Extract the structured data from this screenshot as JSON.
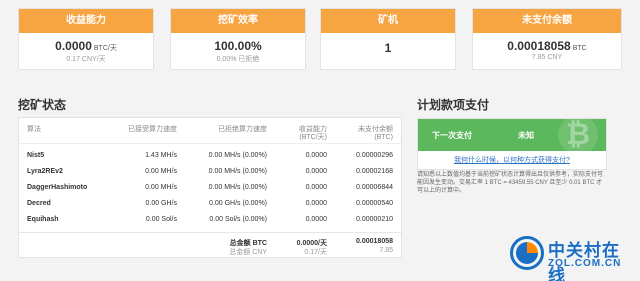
{
  "cards": [
    {
      "title": "收益能力",
      "value": "0.0000",
      "unit": "BTC/天",
      "sub": "0.17 CNY/天"
    },
    {
      "title": "挖矿效率",
      "value": "100.00%",
      "unit": "",
      "sub": "0.00% 已拒绝"
    },
    {
      "title": "矿机",
      "value": "1",
      "unit": "",
      "sub": ""
    },
    {
      "title": "未支付余额",
      "value": "0.00018058",
      "unit": "BTC",
      "sub": "7.85 CNY"
    }
  ],
  "mining_status": {
    "title": "挖矿状态",
    "columns": [
      "算法",
      "已接受算力速度",
      "已拒绝算力速度",
      "收益能力\n(BTC/天)",
      "未支付余额\n(BTC)"
    ],
    "rows": [
      {
        "algo": "Nist5",
        "accepted": "1.43 MH/s",
        "rejected": "0.00 MH/s (0.00%)",
        "profit": "0.0000",
        "unpaid": "0.00000296"
      },
      {
        "algo": "Lyra2REv2",
        "accepted": "0.00 MH/s",
        "rejected": "0.00 MH/s (0.00%)",
        "profit": "0.0000",
        "unpaid": "0.00002168"
      },
      {
        "algo": "DaggerHashimoto",
        "accepted": "0.00 MH/s",
        "rejected": "0.00 MH/s (0.00%)",
        "profit": "0.0000",
        "unpaid": "0.00006844"
      },
      {
        "algo": "Decred",
        "accepted": "0.00 GH/s",
        "rejected": "0.00 GH/s (0.00%)",
        "profit": "0.0000",
        "unpaid": "0.00000540"
      },
      {
        "algo": "Equihash",
        "accepted": "0.00 Sol/s",
        "rejected": "0.00 Sol/s (0.00%)",
        "profit": "0.0000",
        "unpaid": "0.00000210"
      }
    ],
    "total": {
      "label": "总金额 BTC",
      "sub_label": "总金额 CNY",
      "profit": "0.0000/天",
      "profit_cny": "0.17/天",
      "unpaid": "0.00018058",
      "unpaid_cny": "7.85"
    }
  },
  "payment": {
    "title": "计划款项支付",
    "next_label": "下一次支付",
    "next_value": "未知",
    "btc_symbol": "₿",
    "link": "我何什么时候，以何种方式获得支付?",
    "note": "请知悉以上数值均基于当前挖矿状态计算得出且仅供参考，实际支付可能因发生变动。交易汇率 1 BTC = 43459.55 CNY 且至少 0.01 BTC 才可以上的计算中。"
  },
  "watermark": {
    "text": "中关村在线",
    "url": "ZOL.COM.CN"
  }
}
